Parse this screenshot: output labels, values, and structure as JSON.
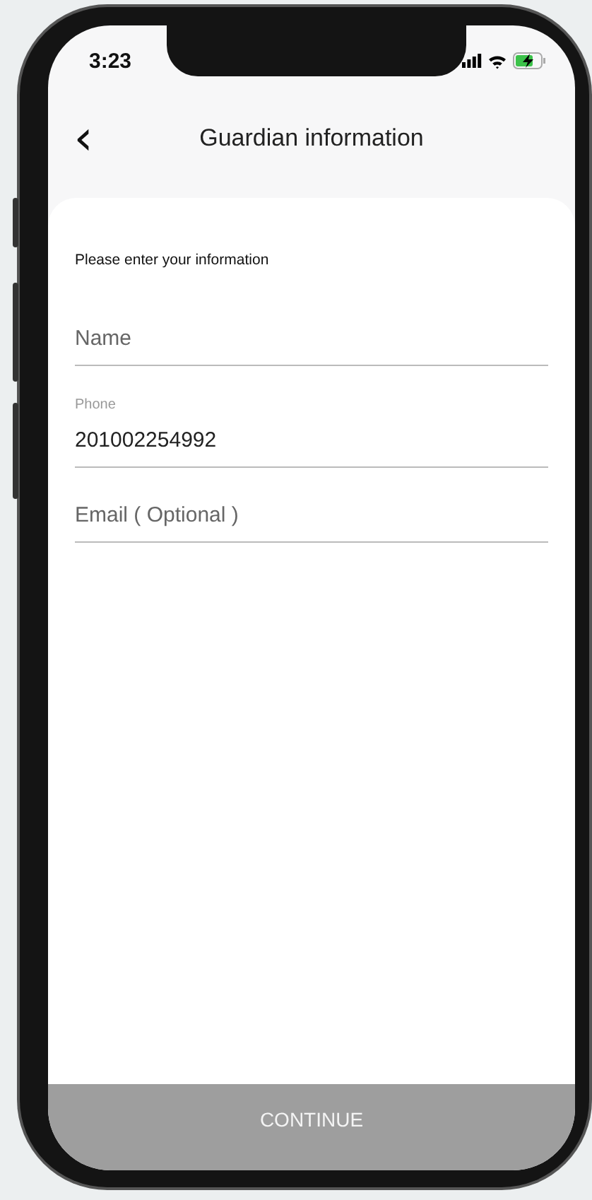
{
  "status_bar": {
    "time": "3:23"
  },
  "header": {
    "back": "‹",
    "title": "Guardian information"
  },
  "intro": "Please enter your information",
  "fields": [
    {
      "placeholder": "Name"
    },
    {
      "label": "Phone",
      "value": "201002254992"
    },
    {
      "placeholder": "Email ( Optional )"
    }
  ],
  "continue_button": {
    "label": "CONTINUE",
    "disabled": true
  }
}
